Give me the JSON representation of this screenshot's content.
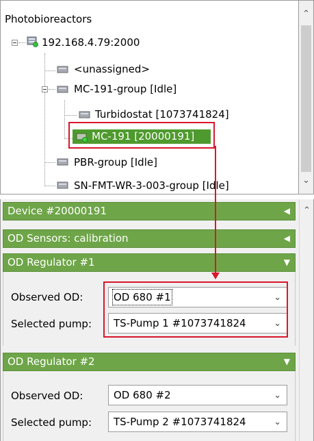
{
  "tree": {
    "root_label": "Photobioreactors",
    "nodes": [
      {
        "label": "192.168.4.79:2000"
      },
      {
        "label": "<unassigned>"
      },
      {
        "label": "MC-191-group [Idle]"
      },
      {
        "label": "Turbidostat [1073741824]"
      },
      {
        "label": "MC-191 [20000191]"
      },
      {
        "label": "PBR-group [Idle]"
      },
      {
        "label": "SN-FMT-WR-3-003-group [Idle]"
      }
    ]
  },
  "panels": {
    "device": {
      "title": "Device #20000191"
    },
    "od_sensors": {
      "title": "OD Sensors: calibration"
    },
    "regulator1": {
      "title": "OD Regulator #1",
      "observed_label": "Observed OD:",
      "observed_value": "OD 680 #1",
      "pump_label": "Selected pump:",
      "pump_value": "TS-Pump 1 #1073741824"
    },
    "regulator2": {
      "title": "OD Regulator #2",
      "observed_label": "Observed OD:",
      "observed_value": "OD 680 #2",
      "pump_label": "Selected pump:",
      "pump_value": "TS-Pump 2 #1073741824"
    }
  },
  "colors": {
    "header_green": "#6ea548",
    "selection_green": "#4f9a2e",
    "annotation_red": "#d9162b"
  },
  "icons": {
    "expand": "minus-box-icon",
    "server": "server-icon",
    "device": "device-icon",
    "online": "green-dot-icon"
  }
}
